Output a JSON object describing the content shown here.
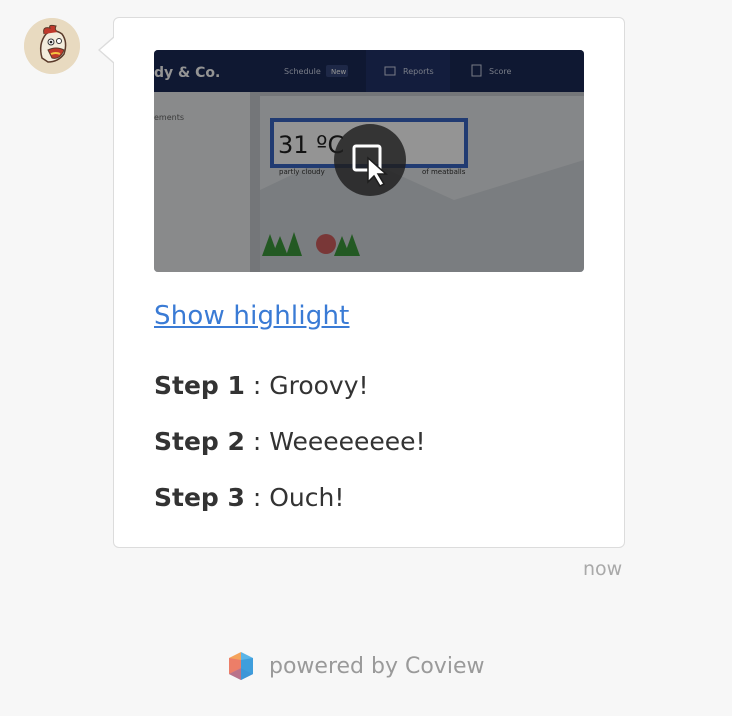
{
  "message": {
    "link_text": "Show highlight",
    "steps": [
      {
        "label": "Step 1",
        "separator": " : ",
        "text": "Groovy!"
      },
      {
        "label": "Step 2",
        "separator": " : ",
        "text": "Weeeeeeee!"
      },
      {
        "label": "Step 3",
        "separator": " : ",
        "text": "Ouch!"
      }
    ],
    "timestamp": "now"
  },
  "preview": {
    "brand": "dy & Co.",
    "nav_schedule": "Schedule",
    "nav_schedule_badge": "New",
    "nav_reports": "Reports",
    "nav_score": "Score",
    "sidebar_text": "ements",
    "temperature": "31 ºC",
    "caption_left": "partly cloudy",
    "caption_right": "of meatballs",
    "play_icon": "screen-cursor-icon"
  },
  "footer": {
    "text": "powered by Coview",
    "logo_icon": "coview-logo-icon"
  },
  "colors": {
    "link": "#3a7bd5",
    "preview_nav": "#1b2a57",
    "highlight_border": "#3a66c4"
  }
}
